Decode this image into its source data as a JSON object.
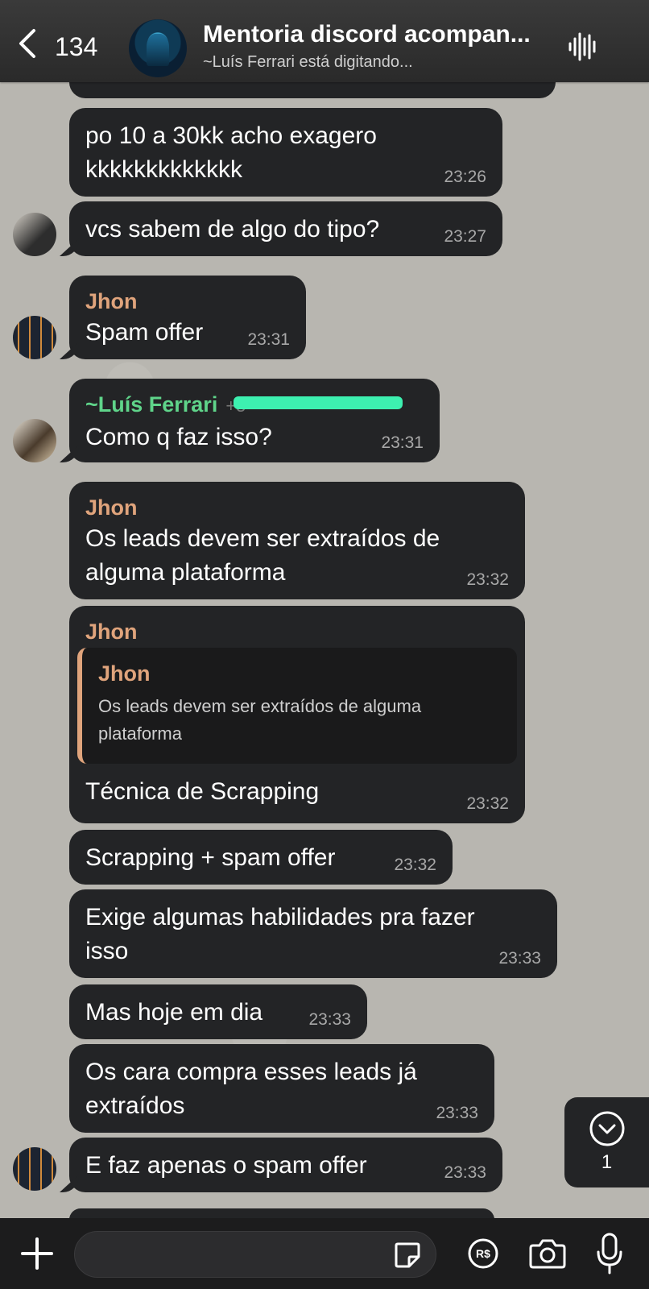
{
  "header": {
    "back_count": "134",
    "title": "Mentoria discord acompan...",
    "subtitle": "~Luís Ferrari está digitando..."
  },
  "messages": [
    {
      "text": "po 10 a 30kk acho exagero\nkkkkkkkkkkkkk",
      "time": "23:26"
    },
    {
      "text": "vcs sabem de algo do tipo?",
      "time": "23:27"
    },
    {
      "sender": "Jhon",
      "text": "Spam offer",
      "time": "23:31"
    },
    {
      "sender": "~Luís Ferrari",
      "text": "Como q faz isso?",
      "time": "23:31"
    },
    {
      "sender": "Jhon",
      "text": "Os leads devem ser extraídos de\nalguma plataforma",
      "time": "23:32"
    },
    {
      "sender": "Jhon",
      "quote_name": "Jhon",
      "quote_text": "Os leads devem ser extraídos de alguma plataforma",
      "text": "Técnica de Scrapping",
      "time": "23:32"
    },
    {
      "text": "Scrapping + spam offer",
      "time": "23:32"
    },
    {
      "text": "Exige algumas habilidades pra fazer\nisso",
      "time": "23:33"
    },
    {
      "text": "Mas hoje em dia",
      "time": "23:33"
    },
    {
      "text": "Os cara compra esses leads já\nextraídos",
      "time": "23:33"
    },
    {
      "text": "E faz apenas o spam offer",
      "time": "23:33"
    }
  ],
  "scroll_button": {
    "unread_count": "1"
  },
  "colors": {
    "sender_jhon": "#e0a47c",
    "sender_luis": "#5fd48a",
    "bubble": "#232426"
  }
}
